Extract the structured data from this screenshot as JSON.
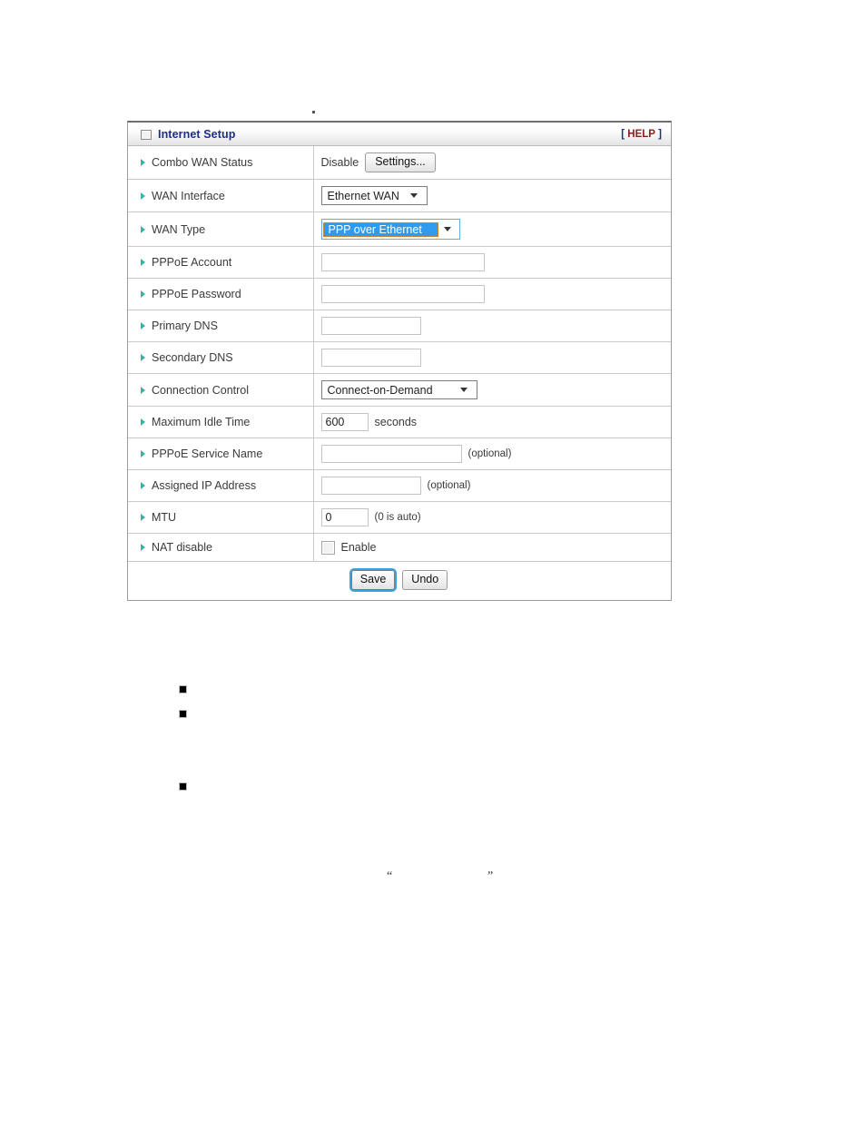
{
  "panel": {
    "icon_name": "window-square-icon",
    "title": "Internet Setup",
    "help_bracket_open": "[",
    "help_label": "HELP",
    "help_bracket_close": "]",
    "accent_title_color": "#1b2e8c",
    "accent_help_color": "#8a2020",
    "bullet_color": "#35b3a5"
  },
  "rows": {
    "combo_wan_status": {
      "label": "Combo WAN Status",
      "status_text": "Disable",
      "settings_button": "Settings..."
    },
    "wan_interface": {
      "label": "WAN Interface",
      "selected": "Ethernet WAN"
    },
    "wan_type": {
      "label": "WAN Type",
      "selected": "PPP over Ethernet",
      "focused": true
    },
    "pppoe_account": {
      "label": "PPPoE Account",
      "value": "",
      "placeholder": ""
    },
    "pppoe_password": {
      "label": "PPPoE Password",
      "value": "",
      "placeholder": ""
    },
    "primary_dns": {
      "label": "Primary DNS",
      "value": "",
      "placeholder": ""
    },
    "secondary_dns": {
      "label": "Secondary DNS",
      "value": "",
      "placeholder": ""
    },
    "connection_control": {
      "label": "Connection Control",
      "selected": "Connect-on-Demand"
    },
    "maximum_idle_time": {
      "label": "Maximum Idle Time",
      "value": "600",
      "unit": "seconds"
    },
    "pppoe_service_name": {
      "label": "PPPoE Service Name",
      "value": "",
      "hint": "(optional)"
    },
    "assigned_ip_address": {
      "label": "Assigned IP Address",
      "value": "",
      "hint": "(optional)"
    },
    "mtu": {
      "label": "MTU",
      "value": "0",
      "hint": "(0 is auto)"
    },
    "nat_disable": {
      "label": "NAT disable",
      "checkbox_label": "Enable",
      "checked": false
    }
  },
  "actions": {
    "save_label": "Save",
    "undo_label": "Undo"
  },
  "document_body": {
    "quote_open": "“",
    "quote_close": "”"
  }
}
